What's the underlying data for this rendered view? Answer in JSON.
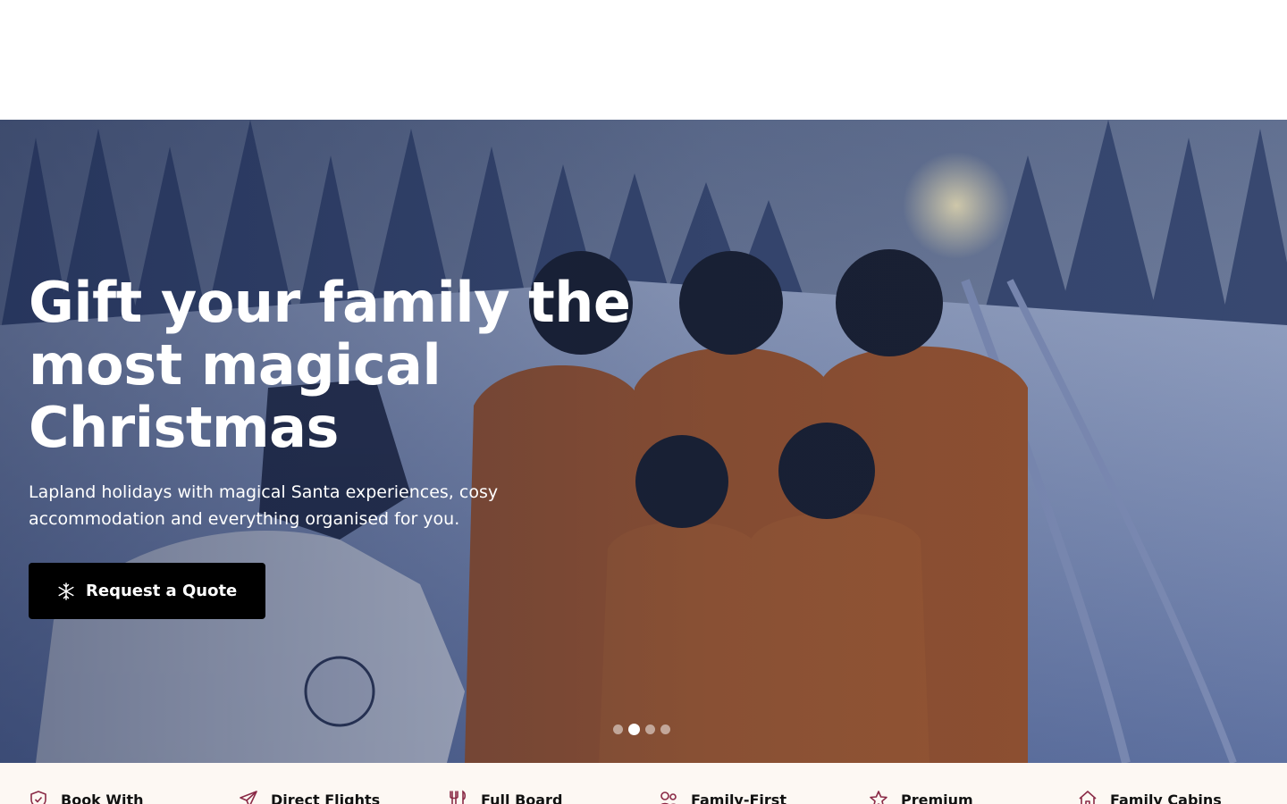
{
  "hero": {
    "title_line1": "Gift your family the",
    "title_line2": "most magical",
    "title_line3": "Christmas",
    "subtitle_line1": "Lapland holidays with magical Santa experiences, cosy",
    "subtitle_line2": "accommodation and everything organised for you.",
    "cta_label": "Request a Quote",
    "cta_icon": "snowflake-icon",
    "slides": {
      "total": 4,
      "active": 2
    }
  },
  "features": [
    {
      "label": "Book With",
      "icon": "shield-icon"
    },
    {
      "label": "Direct Flights",
      "icon": "plane-icon"
    },
    {
      "label": "Full Board",
      "icon": "utensils-icon"
    },
    {
      "label": "Family-First",
      "icon": "family-icon"
    },
    {
      "label": "Premium",
      "icon": "star-icon"
    },
    {
      "label": "Family Cabins",
      "icon": "home-icon"
    }
  ],
  "colors": {
    "icon_accent": "#8a2a46",
    "cta_background": "#000000",
    "features_background": "#fdf8f3"
  }
}
